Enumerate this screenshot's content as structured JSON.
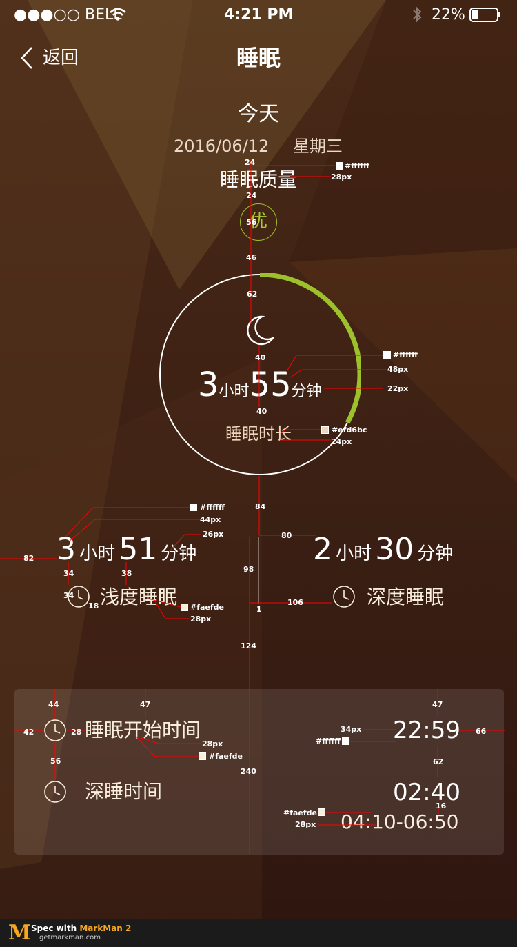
{
  "colors": {
    "background": "#3d2116",
    "accent": "#9dc12a",
    "text": "#ffffff",
    "muted_text": "#efd6bc",
    "secondary_text": "#faefde",
    "annotation": "#ff0000"
  },
  "status_bar": {
    "carrier": "●●●○○ BELL",
    "time": "4:21 PM",
    "battery": "22%",
    "icons": [
      "wifi-icon",
      "bluetooth-icon",
      "battery-icon"
    ]
  },
  "nav": {
    "back_label": "返回",
    "title": "睡眠"
  },
  "header": {
    "day": "今天",
    "date": "2016/06/12",
    "weekday": "星期三"
  },
  "quality": {
    "label": "睡眠质量",
    "badge": "优"
  },
  "duration": {
    "hours": "3",
    "hours_unit": "小时",
    "minutes": "55",
    "minutes_unit": "分钟",
    "label": "睡眠时长",
    "ring_progress": 0.33
  },
  "light_sleep": {
    "hours": "3",
    "hours_unit": "小时",
    "minutes": "51",
    "minutes_unit": "分钟",
    "label": "浅度睡眠"
  },
  "deep_sleep": {
    "hours": "2",
    "hours_unit": "小时",
    "minutes": "30",
    "minutes_unit": "分钟",
    "label": "深度睡眠"
  },
  "details": {
    "start_label": "睡眠开始时间",
    "start_value": "22:59",
    "deep_label": "深睡时间",
    "deep_value": "02:40",
    "deep_range": "04:10-06:50"
  },
  "annotations": {
    "m24a": "24",
    "m24b": "24",
    "m56": "56",
    "m46": "46",
    "m62": "62",
    "m40a": "40",
    "m40b": "40",
    "m84": "84",
    "m80": "80",
    "m82": "82",
    "m34": "34",
    "m38": "38",
    "m98": "98",
    "m34b": "34",
    "m18": "18",
    "m1": "1",
    "m106": "106",
    "m124": "124",
    "m44": "44",
    "m47a": "47",
    "m47b": "47",
    "m42": "42",
    "m28": "28",
    "m66": "66",
    "m56b": "56",
    "m62b": "62",
    "m240": "240",
    "m16": "16",
    "c1": "#ffffff",
    "s1": "28px",
    "c2": "#ffffff",
    "s2": "48px",
    "s3": "22px",
    "c3": "#efd6bc",
    "s4": "24px",
    "c4": "#ffffff",
    "s5": "44px",
    "s6": "26px",
    "c5": "#faefde",
    "s7": "28px",
    "s8": "28px",
    "c6": "#faefde",
    "s9": "34px",
    "c7": "#ffffff",
    "c8": "#faefde",
    "s10": "28px"
  },
  "footer": {
    "logo": "M",
    "brand_prefix": "Spec with ",
    "brand_name": "MarkMan 2",
    "site": "getmarkman.com"
  }
}
